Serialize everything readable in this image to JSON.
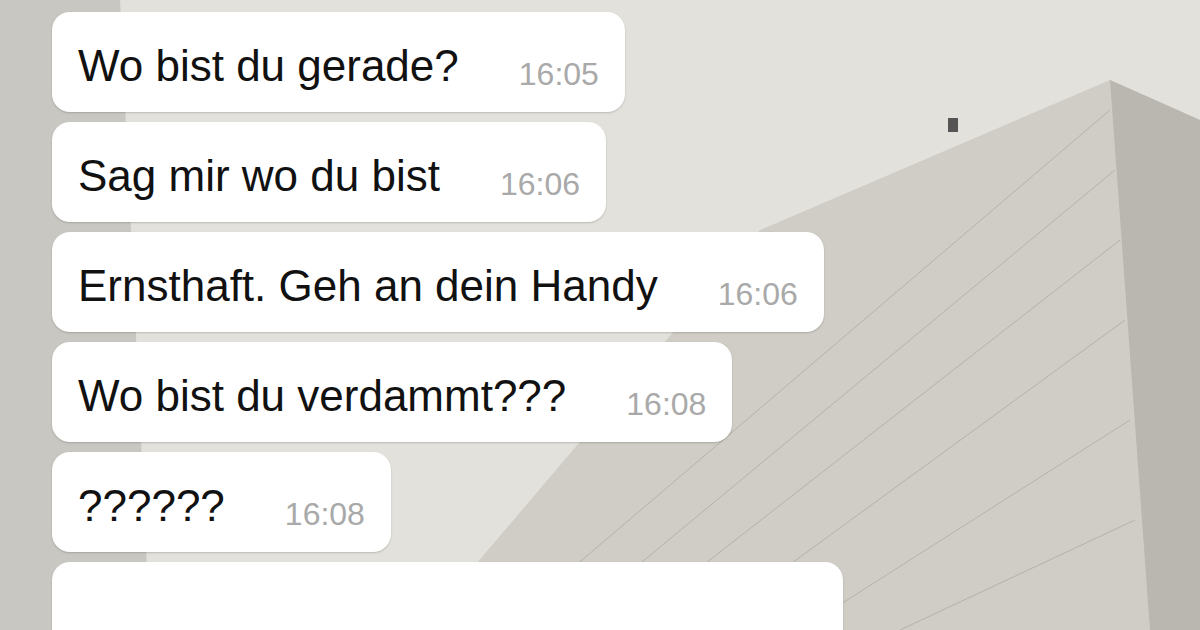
{
  "messages": [
    {
      "text": "Wo bist du gerade?",
      "time": "16:05"
    },
    {
      "text": "Sag mir wo du bist",
      "time": "16:06"
    },
    {
      "text": "Ernsthaft. Geh an dein Handy",
      "time": "16:06"
    },
    {
      "text": "Wo bist du verdammt???",
      "time": "16:08"
    },
    {
      "text": "??????",
      "time": "16:08"
    }
  ]
}
